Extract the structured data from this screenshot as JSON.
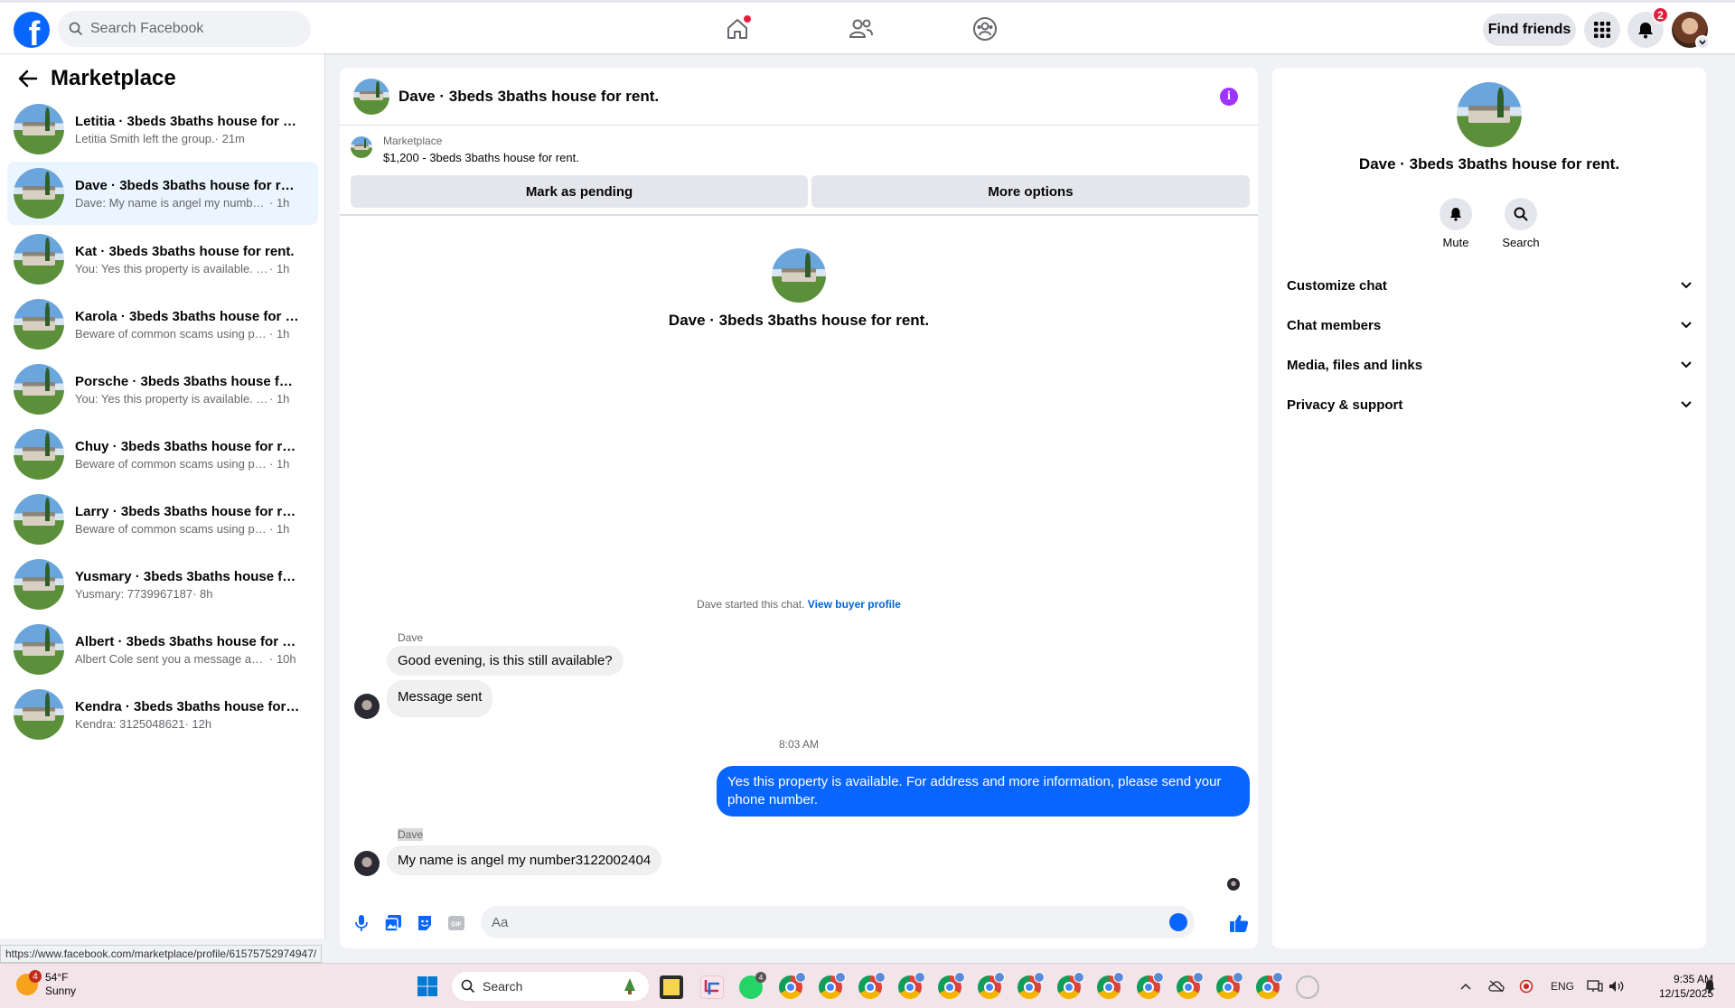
{
  "topbar": {
    "logo": "f",
    "search_placeholder": "Search Facebook",
    "find_friends": "Find friends",
    "notifications_count": "2",
    "icons": [
      "home-icon",
      "friends-icon",
      "groups-icon",
      "menu-grid-icon",
      "bell-icon"
    ]
  },
  "sidebar": {
    "title": "Marketplace",
    "conversations": [
      {
        "title": "Letitia · 3beds 3baths house for re...",
        "preview": "Letitia Smith left the group.",
        "time": " · 21m"
      },
      {
        "title": "Dave · 3beds 3baths house for rent.",
        "preview": "Dave: My name is angel my number3...",
        "time": " · 1h"
      },
      {
        "title": "Kat · 3beds 3baths house for rent.",
        "preview": "You: Yes this property is available. For ...",
        "time": " · 1h"
      },
      {
        "title": "Karola · 3beds 3baths house for re...",
        "preview": "Beware of common scams using pay...",
        "time": " · 1h"
      },
      {
        "title": "Porsche · 3beds 3baths house for r...",
        "preview": "You: Yes this property is available. For ...",
        "time": " · 1h"
      },
      {
        "title": "Chuy · 3beds 3baths house for rent.",
        "preview": "Beware of common scams using pay...",
        "time": " · 1h"
      },
      {
        "title": "Larry · 3beds 3baths house for rent.",
        "preview": "Beware of common scams using pay...",
        "time": " · 1h"
      },
      {
        "title": "Yusmary · 3beds 3baths house for ...",
        "preview": "Yusmary: 7739967187",
        "time": " · 8h"
      },
      {
        "title": "Albert · 3beds 3baths house for re...",
        "preview": "Albert Cole sent you a message abo...",
        "time": " · 10h"
      },
      {
        "title": "Kendra · 3beds 3baths house for r...",
        "preview": "Kendra: 3125048621",
        "time": " · 12h"
      }
    ]
  },
  "chat": {
    "title": "Dave · 3beds 3baths house for rent.",
    "marketplace_label": "Marketplace",
    "listing": "$1,200 - 3beds 3baths house for rent.",
    "mark_pending": "Mark as pending",
    "more_options": "More options",
    "intro_title": "Dave · 3beds 3baths house for rent.",
    "started_text": "Dave started this chat.",
    "view_buyer_profile": "View buyer profile",
    "sender_name": "Dave",
    "msg1": "Good evening, is this still available?",
    "msg2": "Message sent",
    "time_sep": "8:03 AM",
    "msg_out": "Yes this property is available. For address and more information, please send your phone number.",
    "sender_name2": "Dave",
    "msg3": "My name is angel my number3122002404",
    "composer_placeholder": "Aa"
  },
  "details": {
    "title": "Dave · 3beds 3baths house for rent.",
    "mute": "Mute",
    "search": "Search",
    "rows": [
      "Customize chat",
      "Chat members",
      "Media, files and links",
      "Privacy & support"
    ]
  },
  "status_url": "https://www.facebook.com/marketplace/profile/61575752974947/",
  "taskbar": {
    "weather_alerts": "4",
    "temp": "54°F",
    "condition": "Sunny",
    "search": "Search",
    "lang": "ENG",
    "time": "9:35 AM",
    "date": "12/15/2025",
    "whatsapp_badge": "4"
  },
  "colors": {
    "brand_blue": "#0866ff",
    "active_row": "#ebf5ff",
    "info_purple": "#a033ff",
    "badge_red": "#e41e3f"
  }
}
